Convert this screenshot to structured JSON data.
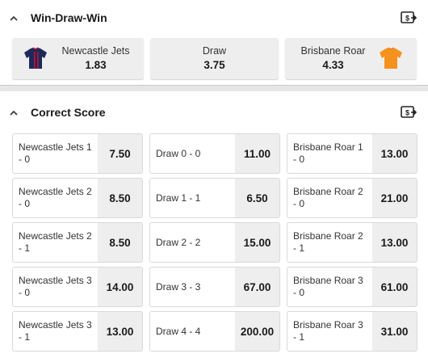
{
  "win_draw_win": {
    "title": "Win-Draw-Win",
    "options": [
      {
        "name": "Newcastle Jets",
        "odds": "1.83",
        "icon": "newcastle-jersey-icon"
      },
      {
        "name": "Draw",
        "odds": "3.75"
      },
      {
        "name": "Brisbane Roar",
        "odds": "4.33",
        "icon": "brisbane-jersey-icon"
      }
    ]
  },
  "correct_score": {
    "title": "Correct Score",
    "rows": [
      [
        {
          "label": "Newcastle Jets 1 - 0",
          "odds": "7.50"
        },
        {
          "label": "Draw 0 - 0",
          "odds": "11.00"
        },
        {
          "label": "Brisbane Roar 1 - 0",
          "odds": "13.00"
        }
      ],
      [
        {
          "label": "Newcastle Jets 2 - 0",
          "odds": "8.50"
        },
        {
          "label": "Draw 1 - 1",
          "odds": "6.50"
        },
        {
          "label": "Brisbane Roar 2 - 0",
          "odds": "21.00"
        }
      ],
      [
        {
          "label": "Newcastle Jets 2 - 1",
          "odds": "8.50"
        },
        {
          "label": "Draw 2 - 2",
          "odds": "15.00"
        },
        {
          "label": "Brisbane Roar 2 - 1",
          "odds": "13.00"
        }
      ],
      [
        {
          "label": "Newcastle Jets 3 - 0",
          "odds": "14.00"
        },
        {
          "label": "Draw 3 - 3",
          "odds": "67.00"
        },
        {
          "label": "Brisbane Roar 3 - 0",
          "odds": "61.00"
        }
      ],
      [
        {
          "label": "Newcastle Jets 3 - 1",
          "odds": "13.00"
        },
        {
          "label": "Draw 4 - 4",
          "odds": "200.00"
        },
        {
          "label": "Brisbane Roar 3 - 1",
          "odds": "31.00"
        }
      ]
    ]
  },
  "colors": {
    "newcastle_navy": "#1c2a5a",
    "newcastle_red": "#c8102e",
    "brisbane_orange": "#f5921e"
  }
}
